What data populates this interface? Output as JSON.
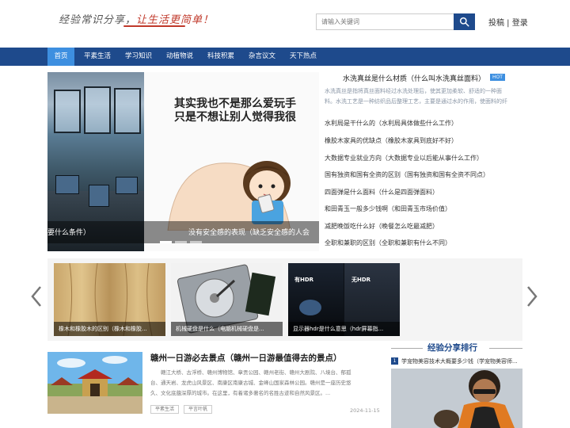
{
  "header": {
    "logo_part1": "经验常识分享，",
    "logo_part2": "让生活更简单！",
    "search_placeholder": "请输入关键词",
    "auth_post": "投稿",
    "auth_sep": " | ",
    "auth_login": "登录"
  },
  "nav": {
    "items": [
      "首页",
      "平素生活",
      "学习知识",
      "动植物说",
      "科技积累",
      "杂言议文",
      "天下热点"
    ]
  },
  "slider": {
    "cartoon_line1": "其实我也不是那么爱玩手",
    "cartoon_line2": "只是不想让别人觉得我很",
    "caption_left": "要什么条件）",
    "caption_right": "没有安全感的表现（缺乏安全感的人会",
    "active_dot": 0
  },
  "hot": {
    "title": "水洗真丝是什么材质（什么叫水洗真丝面料）",
    "badge": "HOT",
    "desc_line1": "水洗真丝是指将真丝面料经过水洗处理后，使其更加柔软、舒适的一种面",
    "desc_line2": "料。水洗工艺是一种纺织品后整理工艺，主要是通过水的作用，使面料的纤",
    "list": [
      "水利局是干什么的（水利局具体做些什么工作）",
      "橡胶木家具的优缺点（橡胶木家具到底好不好）",
      "大数据专业就业方向（大数据专业以后能从事什么工作）",
      "国有独资和国有全资的区别（国有独资和国有全资不同点）",
      "四面弹是什么面料（什么是四面弹面料）",
      "和田青玉一般多少钱啊（和田青玉市场价值）",
      "减肥晚饭吃什么好（晚餐怎么吃最减肥）",
      "全职和兼职的区别（全职和兼职有什么不同）"
    ]
  },
  "carousel": {
    "cards": [
      {
        "caption": "橡木和橡胶木的区别（橡木和橡胶..."
      },
      {
        "caption": "机械硬盘是什么（电脑机械硬盘是..."
      },
      {
        "caption": "显示器hdr是什么意思（hdr屏幕指...",
        "hdr_label": "有HDR",
        "nohdr_label": "无HDR"
      }
    ]
  },
  "article": {
    "title": "赣州一日游必去景点（赣州一日游最值得去的景点）",
    "body_line1": "　　赣江大桥、古浮桥、赣州博物馆、章贡公园、赣州老街、赣州大剧院、八境台、郁孤",
    "body_line2": "台、通天岩、龙虎山风景区、南康区南康古城、金峰山国家森林公园。赣州是一座历史悠",
    "body_line3": "久、文化底蕴深厚的城市。在这里，有着诸多著名的名胜古迹和自然风景区。...",
    "tags": [
      "平素生活",
      "平言叶帆"
    ],
    "date": "2024-11-15"
  },
  "ranking": {
    "title": "经验分享排行",
    "first_num": "1",
    "first_text": "学宠物美容技术大概要多少钱（学宠物美容师..."
  }
}
